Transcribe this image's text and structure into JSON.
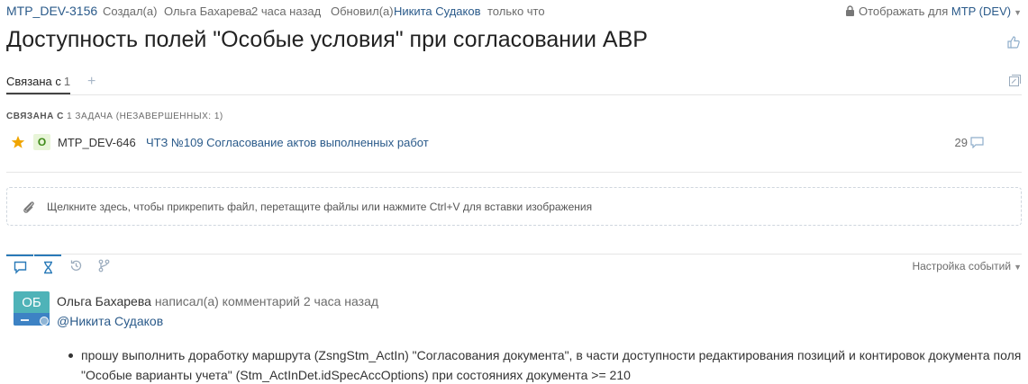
{
  "header": {
    "issue_key": "MTP_DEV-3156",
    "created_label": "Создал(а)",
    "creator": "Ольга Бахарева",
    "created_time": "2 часа назад",
    "updated_label": "Обновил(а)",
    "updater": "Никита Судаков",
    "updated_time": "только что",
    "visibility_label": "Отображать для",
    "visibility_value": "MTP (DEV)"
  },
  "title": "Доступность полей \"Особые условия\" при согласовании АВР",
  "tabs": {
    "related_label": "Связана с",
    "related_count": "1",
    "add_symbol": "+"
  },
  "related": {
    "section_title": "СВЯЗАНА С",
    "section_summary": "1 ЗАДАЧА (НЕЗАВЕРШЕННЫХ: 1)",
    "tasks": [
      {
        "status": "О",
        "key": "MTP_DEV-646",
        "title": "ЧТЗ №109 Согласование актов выполненных работ",
        "comments": "29"
      }
    ]
  },
  "attach": {
    "text": "Щелкните здесь, чтобы прикрепить файл, перетащите файлы или нажмите Ctrl+V для вставки изображения"
  },
  "activity": {
    "tabs": [
      "comments-icon",
      "hourglass-icon",
      "history-icon",
      "branch-icon"
    ],
    "settings_label": "Настройка событий"
  },
  "comment": {
    "avatar_initials": "ОБ",
    "author": "Ольга Бахарева",
    "action": "написал(а) комментарий 2 часа назад",
    "mention": "@Никита Судаков",
    "body_item": "прошу выполнить доработку маршрута (ZsngStm_ActIn) \"Согласования документа\", в части доступности редактирования позиций и контировок документа поля \"Особые варианты учета\" (Stm_ActInDet.idSpecAccOptions) при состояниях документа >= 210"
  },
  "colors": {
    "link": "#2a5a8a",
    "accent": "#2a7ab8",
    "avatar_bg": "#4fb3b8",
    "status_green": "#3e8a18",
    "star": "#f0a500"
  }
}
